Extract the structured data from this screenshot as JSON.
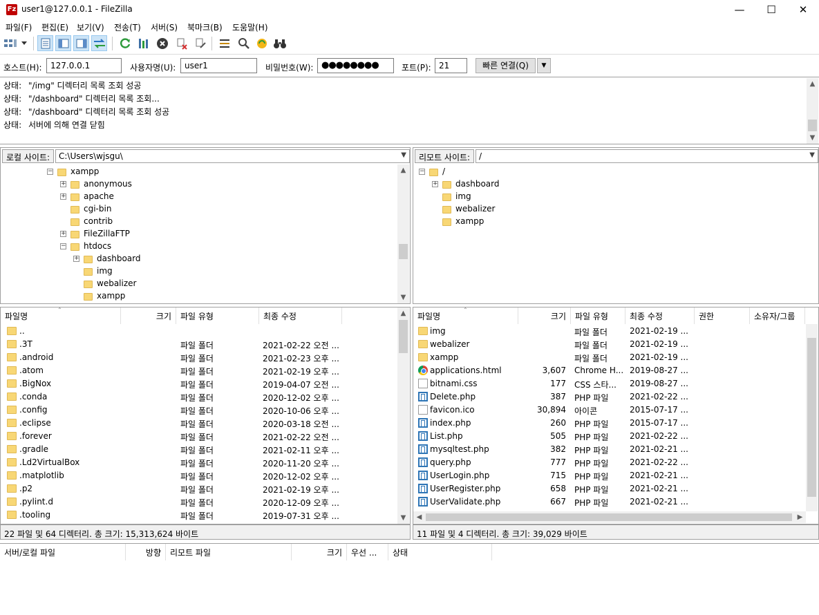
{
  "window": {
    "title": "user1@127.0.0.1 - FileZilla",
    "app_icon": "Fz"
  },
  "menu": [
    "파일(F)",
    "편집(E)",
    "보기(V)",
    "전송(T)",
    "서버(S)",
    "북마크(B)",
    "도움말(H)"
  ],
  "quickconnect": {
    "host_label": "호스트(H):",
    "host_value": "127.0.0.1",
    "user_label": "사용자명(U):",
    "user_value": "user1",
    "pass_label": "비밀번호(W):",
    "pass_value": "●●●●●●●●",
    "port_label": "포트(P):",
    "port_value": "21",
    "button_label": "빠른 연결(Q)"
  },
  "log": [
    {
      "key": "상태:",
      "msg": "\"/img\" 디렉터리 목록 조회 성공"
    },
    {
      "key": "상태:",
      "msg": "\"/dashboard\" 디렉터리 목록 조회..."
    },
    {
      "key": "상태:",
      "msg": "\"/dashboard\" 디렉터리 목록 조회 성공"
    },
    {
      "key": "상태:",
      "msg": "서버에 의해 연결 닫힘"
    }
  ],
  "local": {
    "site_label": "로컬 사이트:",
    "path": "C:\\Users\\wjsgu\\",
    "tree": [
      {
        "label": "xampp",
        "exp": "−"
      },
      {
        "label": "anonymous",
        "exp": "+"
      },
      {
        "label": "apache",
        "exp": "+"
      },
      {
        "label": "cgi-bin",
        "exp": ""
      },
      {
        "label": "contrib",
        "exp": ""
      },
      {
        "label": "FileZillaFTP",
        "exp": "+"
      },
      {
        "label": "htdocs",
        "exp": "−"
      },
      {
        "label": "dashboard",
        "exp": "+"
      },
      {
        "label": "img",
        "exp": ""
      },
      {
        "label": "webalizer",
        "exp": ""
      },
      {
        "label": "xampp",
        "exp": ""
      }
    ],
    "columns": [
      "파일명",
      "크기",
      "파일 유형",
      "최종 수정"
    ],
    "files": [
      {
        "name": "..",
        "size": "",
        "type": "",
        "date": ""
      },
      {
        "name": ".3T",
        "size": "",
        "type": "파일 폴더",
        "date": "2021-02-22 오전 ..."
      },
      {
        "name": ".android",
        "size": "",
        "type": "파일 폴더",
        "date": "2021-02-23 오후 ..."
      },
      {
        "name": ".atom",
        "size": "",
        "type": "파일 폴더",
        "date": "2021-02-19 오후 ..."
      },
      {
        "name": ".BigNox",
        "size": "",
        "type": "파일 폴더",
        "date": "2019-04-07 오전 ..."
      },
      {
        "name": ".conda",
        "size": "",
        "type": "파일 폴더",
        "date": "2020-12-02 오후 ..."
      },
      {
        "name": ".config",
        "size": "",
        "type": "파일 폴더",
        "date": "2020-10-06 오후 ..."
      },
      {
        "name": ".eclipse",
        "size": "",
        "type": "파일 폴더",
        "date": "2020-03-18 오전 ..."
      },
      {
        "name": ".forever",
        "size": "",
        "type": "파일 폴더",
        "date": "2021-02-22 오전 ..."
      },
      {
        "name": ".gradle",
        "size": "",
        "type": "파일 폴더",
        "date": "2021-02-11 오후 ..."
      },
      {
        "name": ".Ld2VirtualBox",
        "size": "",
        "type": "파일 폴더",
        "date": "2020-11-20 오후 ..."
      },
      {
        "name": ".matplotlib",
        "size": "",
        "type": "파일 폴더",
        "date": "2020-12-02 오후 ..."
      },
      {
        "name": ".p2",
        "size": "",
        "type": "파일 폴더",
        "date": "2021-02-19 오후 ..."
      },
      {
        "name": ".pylint.d",
        "size": "",
        "type": "파일 폴더",
        "date": "2020-12-09 오후 ..."
      },
      {
        "name": ".tooling",
        "size": "",
        "type": "파일 폴더",
        "date": "2019-07-31 오후 ..."
      }
    ],
    "status": "22 파일 및 64 디렉터리. 총 크기: 15,313,624 바이트"
  },
  "remote": {
    "site_label": "리모트 사이트:",
    "path": "/",
    "tree": [
      {
        "label": "/",
        "exp": "−"
      },
      {
        "label": "dashboard",
        "exp": "+"
      },
      {
        "label": "img",
        "exp": ""
      },
      {
        "label": "webalizer",
        "exp": ""
      },
      {
        "label": "xampp",
        "exp": ""
      }
    ],
    "columns": [
      "파일명",
      "크기",
      "파일 유형",
      "최종 수정",
      "권한",
      "소유자/그룹"
    ],
    "files": [
      {
        "icon": "folder",
        "name": "img",
        "size": "",
        "type": "파일 폴더",
        "date": "2021-02-19 ..."
      },
      {
        "icon": "folder",
        "name": "webalizer",
        "size": "",
        "type": "파일 폴더",
        "date": "2021-02-19 ..."
      },
      {
        "icon": "folder",
        "name": "xampp",
        "size": "",
        "type": "파일 폴더",
        "date": "2021-02-19 ..."
      },
      {
        "icon": "html",
        "name": "applications.html",
        "size": "3,607",
        "type": "Chrome H...",
        "date": "2019-08-27 ..."
      },
      {
        "icon": "doc",
        "name": "bitnami.css",
        "size": "177",
        "type": "CSS 스타...",
        "date": "2019-08-27 ..."
      },
      {
        "icon": "php",
        "name": "Delete.php",
        "size": "387",
        "type": "PHP 파일",
        "date": "2021-02-22 ..."
      },
      {
        "icon": "doc",
        "name": "favicon.ico",
        "size": "30,894",
        "type": "아이콘",
        "date": "2015-07-17 ..."
      },
      {
        "icon": "php",
        "name": "index.php",
        "size": "260",
        "type": "PHP 파일",
        "date": "2015-07-17 ..."
      },
      {
        "icon": "php",
        "name": "List.php",
        "size": "505",
        "type": "PHP 파일",
        "date": "2021-02-22 ..."
      },
      {
        "icon": "php",
        "name": "mysqltest.php",
        "size": "382",
        "type": "PHP 파일",
        "date": "2021-02-21 ..."
      },
      {
        "icon": "php",
        "name": "query.php",
        "size": "777",
        "type": "PHP 파일",
        "date": "2021-02-22 ..."
      },
      {
        "icon": "php",
        "name": "UserLogin.php",
        "size": "715",
        "type": "PHP 파일",
        "date": "2021-02-21 ..."
      },
      {
        "icon": "php",
        "name": "UserRegister.php",
        "size": "658",
        "type": "PHP 파일",
        "date": "2021-02-21 ..."
      },
      {
        "icon": "php",
        "name": "UserValidate.php",
        "size": "667",
        "type": "PHP 파일",
        "date": "2021-02-21 ..."
      }
    ],
    "status": "11 파일 및 4 디렉터리. 총 크기: 39,029 바이트"
  },
  "queue": {
    "columns": [
      "서버/로컬 파일",
      "방향",
      "리모트 파일",
      "크기",
      "우선 ...",
      "상태"
    ]
  }
}
